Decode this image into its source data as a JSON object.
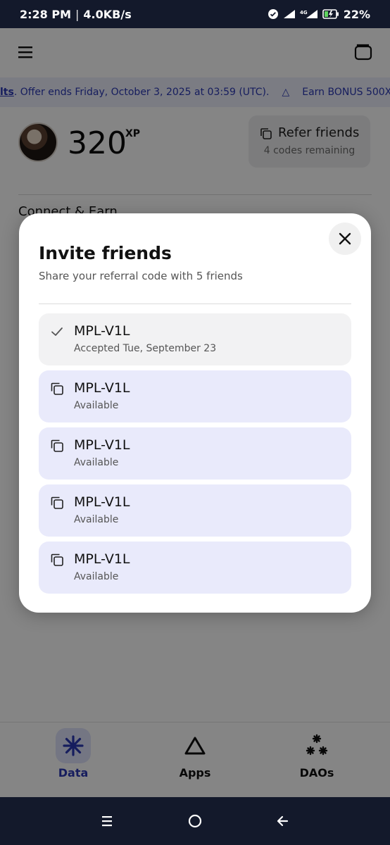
{
  "status_bar": {
    "time": "2:28 PM",
    "speed": "4.0KB/s",
    "network": "4G",
    "battery": "22%"
  },
  "ticker": {
    "lead": "lts",
    "offer": ". Offer ends Friday, October 3, 2025 at 03:59 (UTC).",
    "next": "Earn BONUS 500X"
  },
  "profile": {
    "xp_value": "320",
    "xp_unit": "XP"
  },
  "refer": {
    "title": "Refer friends",
    "subtitle": "4 codes remaining"
  },
  "section": {
    "label": "Connect & Earn"
  },
  "modal": {
    "title": "Invite friends",
    "subtitle": "Share your referral code with 5 friends",
    "codes": [
      {
        "code": "MPL-V1L",
        "status": "Accepted Tue, September 23",
        "state": "accepted"
      },
      {
        "code": "MPL-V1L",
        "status": "Available",
        "state": "available"
      },
      {
        "code": "MPL-V1L",
        "status": "Available",
        "state": "available"
      },
      {
        "code": "MPL-V1L",
        "status": "Available",
        "state": "available"
      },
      {
        "code": "MPL-V1L",
        "status": "Available",
        "state": "available"
      }
    ]
  },
  "nav": {
    "data": "Data",
    "apps": "Apps",
    "daos": "DAOs"
  },
  "colors": {
    "accent": "#2b39b5",
    "available_bg": "#e9eafb",
    "accepted_bg": "#f2f2f3",
    "system_bar": "#13192b"
  },
  "icons": {
    "menu": "hamburger-icon",
    "wallet": "wallet-icon",
    "copy": "copy-icon",
    "check": "check-icon",
    "close": "close-icon",
    "data": "asterisk-icon",
    "apps": "triangle-icon",
    "daos": "cluster-icon"
  }
}
